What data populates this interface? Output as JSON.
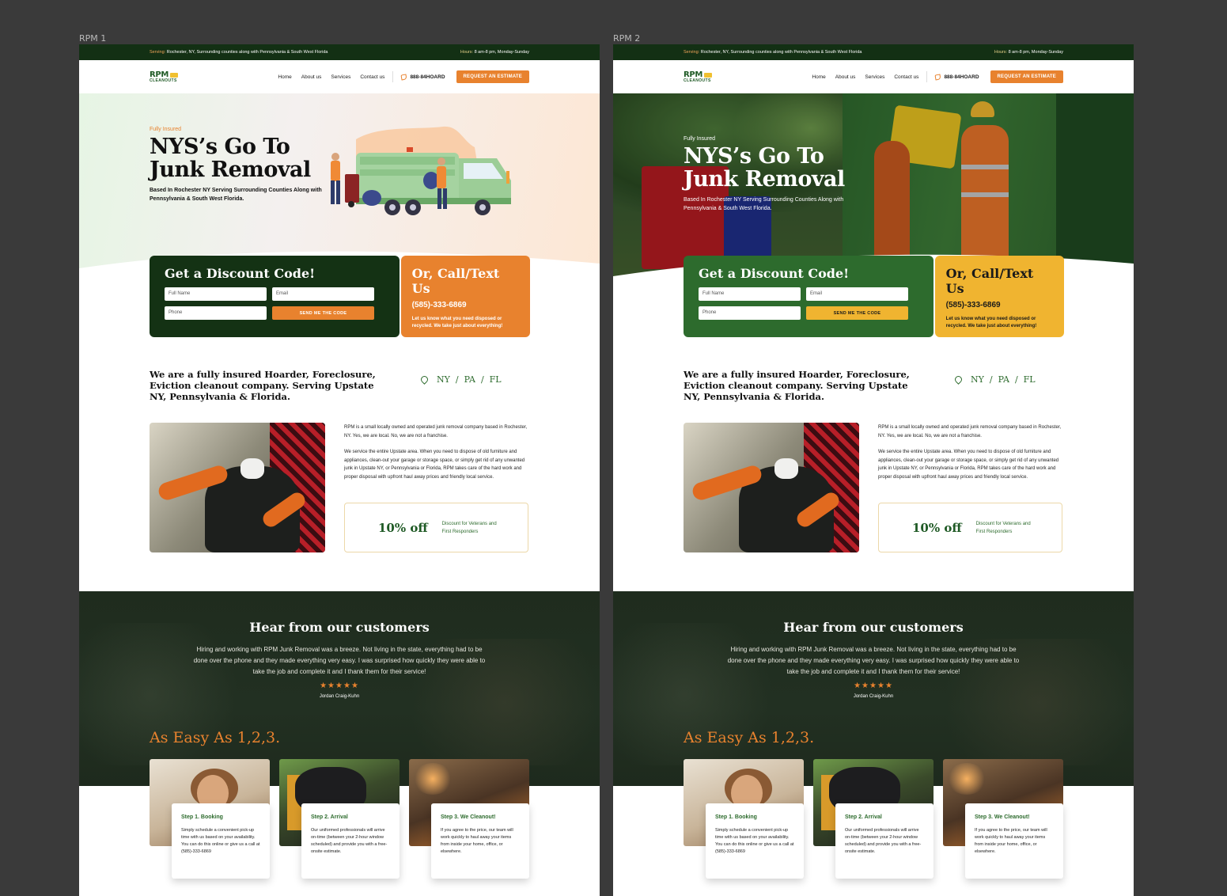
{
  "frames": [
    {
      "label": "RPM 1",
      "topbar": {
        "serving_key": "Serving:",
        "serving_text": "Rochester, NY, Surrounding counties along with Pennsylvania & South West Florida",
        "hours_key": "Hours:",
        "hours_text": "8 am-8 pm, Monday-Sunday"
      },
      "nav": {
        "logo_top": "RPM",
        "logo_bottom": "CLEANOUTS",
        "links": [
          "Home",
          "About us",
          "Services",
          "Contact us"
        ],
        "phone": "888-84HOARD",
        "cta": "REQUEST AN ESTIMATE"
      },
      "hero": {
        "eyebrow": "Fully Insured",
        "title_line1": "NYS’s Go To",
        "title_line2": "Junk Removal",
        "subtitle": "Based In Rochester NY Serving Surrounding Counties Along with Pennsylvania & South West Florida."
      },
      "form": {
        "title": "Get a Discount Code!",
        "full_name_placeholder": "Full Name",
        "email_placeholder": "Email",
        "phone_placeholder": "Phone",
        "submit": "SEND ME THE CODE"
      },
      "call": {
        "title": "Or, Call/Text Us",
        "number": "(585)-333-6869",
        "note": "Let us know what you need disposed or recycled. We take just about everything!"
      },
      "about": {
        "heading": "We are a fully insured Hoarder, Foreclosure, Eviction cleanout company. Serving Upstate NY, Pennsylvania & Florida.",
        "states": [
          "NY",
          "PA",
          "FL"
        ],
        "para1": "RPM is a small locally owned and operated junk removal company based in Rochester, NY. Yes, we are local. No, we are not a franchise.",
        "para2": "We service the entire Upstate area. When you need to dispose of old furniture and appliances, clean-out your garage or storage space, or simply get rid of any unwanted junk in Upstate NY, or Pennsylvania or Florida, RPM takes care of the hard work and proper disposal with upfront haul away prices and friendly local service.",
        "discount": "10% off",
        "discount_note": "Discount for Veterans and First Responders"
      },
      "testimonial": {
        "heading": "Hear from our customers",
        "quote": "Hiring and working with RPM Junk Removal was a breeze.  Not living in the state, everything had to be done over the phone and they made everything very easy.  I was surprised how quickly they were able to take the job and complete it and I thank them for their service!",
        "stars": "★★★★★",
        "author": "Jordan Craig-Kuhn"
      },
      "steps": {
        "heading": "As Easy As 1,2,3.",
        "items": [
          {
            "title": "Step 1. Booking",
            "text": "Simply schedule a convenient pick-up time with us based on your availability. You can do this online or give us a call at (585)-333-6869"
          },
          {
            "title": "Step 2. Arrival",
            "text": "Our uniformed professionals will arrive on-time (between your 2-hour window scheduled) and provide you with a free-onsite estimate."
          },
          {
            "title": "Step 3. We Cleanout!",
            "text": "If you agree to the price, our team will work quickly to haul away your items from inside your home, office, or elsewhere."
          }
        ]
      },
      "colors": {
        "form_bg": "#143214",
        "call_bg": "#e8822e",
        "accent": "#e8822e"
      }
    },
    {
      "label": "RPM 2",
      "topbar": {
        "serving_key": "Serving:",
        "serving_text": "Rochester, NY, Surrounding counties along with Pennsylvania & South West Florida",
        "hours_key": "Hours:",
        "hours_text": "8 am-8 pm, Monday-Sunday"
      },
      "nav": {
        "logo_top": "RPM",
        "logo_bottom": "CLEANOUTS",
        "links": [
          "Home",
          "About us",
          "Services",
          "Contact us"
        ],
        "phone": "888-84HOARD",
        "cta": "REQUEST AN ESTIMATE"
      },
      "hero": {
        "eyebrow": "Fully Insured",
        "title_line1": "NYS’s Go To",
        "title_line2": "Junk Removal",
        "subtitle": "Based In Rochester NY Serving Surrounding Counties Along with Pennsylvania & South West Florida."
      },
      "form": {
        "title": "Get a Discount Code!",
        "full_name_placeholder": "Full Name",
        "email_placeholder": "Email",
        "phone_placeholder": "Phone",
        "submit": "SEND ME THE CODE"
      },
      "call": {
        "title": "Or, Call/Text Us",
        "number": "(585)-333-6869",
        "note": "Let us know what you need disposed or recycled. We take just about everything!"
      },
      "about": {
        "heading": "We are a fully insured Hoarder, Foreclosure, Eviction cleanout company. Serving Upstate NY, Pennsylvania & Florida.",
        "states": [
          "NY",
          "PA",
          "FL"
        ],
        "para1": "RPM is a small locally owned and operated junk removal company based in Rochester, NY. Yes, we are local. No, we are not a franchise.",
        "para2": "We service the entire Upstate area. When you need to dispose of old furniture and appliances, clean-out your garage or storage space, or simply get rid of any unwanted junk in Upstate NY, or Pennsylvania or Florida, RPM takes care of the hard work and proper disposal with upfront haul away prices and friendly local service.",
        "discount": "10% off",
        "discount_note": "Discount for Veterans and First Responders"
      },
      "testimonial": {
        "heading": "Hear from our customers",
        "quote": "Hiring and working with RPM Junk Removal was a breeze.  Not living in the state, everything had to be done over the phone and they made everything very easy.  I was surprised how quickly they were able to take the job and complete it and I thank them for their service!",
        "stars": "★★★★★",
        "author": "Jordan Craig-Kuhn"
      },
      "steps": {
        "heading": "As Easy As 1,2,3.",
        "items": [
          {
            "title": "Step 1. Booking",
            "text": "Simply schedule a convenient pick-up time with us based on your availability. You can do this online or give us a call at (585)-333-6869"
          },
          {
            "title": "Step 2. Arrival",
            "text": "Our uniformed professionals will arrive on-time (between your 2-hour window scheduled) and provide you with a free-onsite estimate."
          },
          {
            "title": "Step 3. We Cleanout!",
            "text": "If you agree to the price, our team will work quickly to haul away your items from inside your home, office, or elsewhere."
          }
        ]
      },
      "colors": {
        "form_bg": "#2d6b2d",
        "call_bg": "#f0b430",
        "accent": "#e8822e"
      }
    }
  ]
}
